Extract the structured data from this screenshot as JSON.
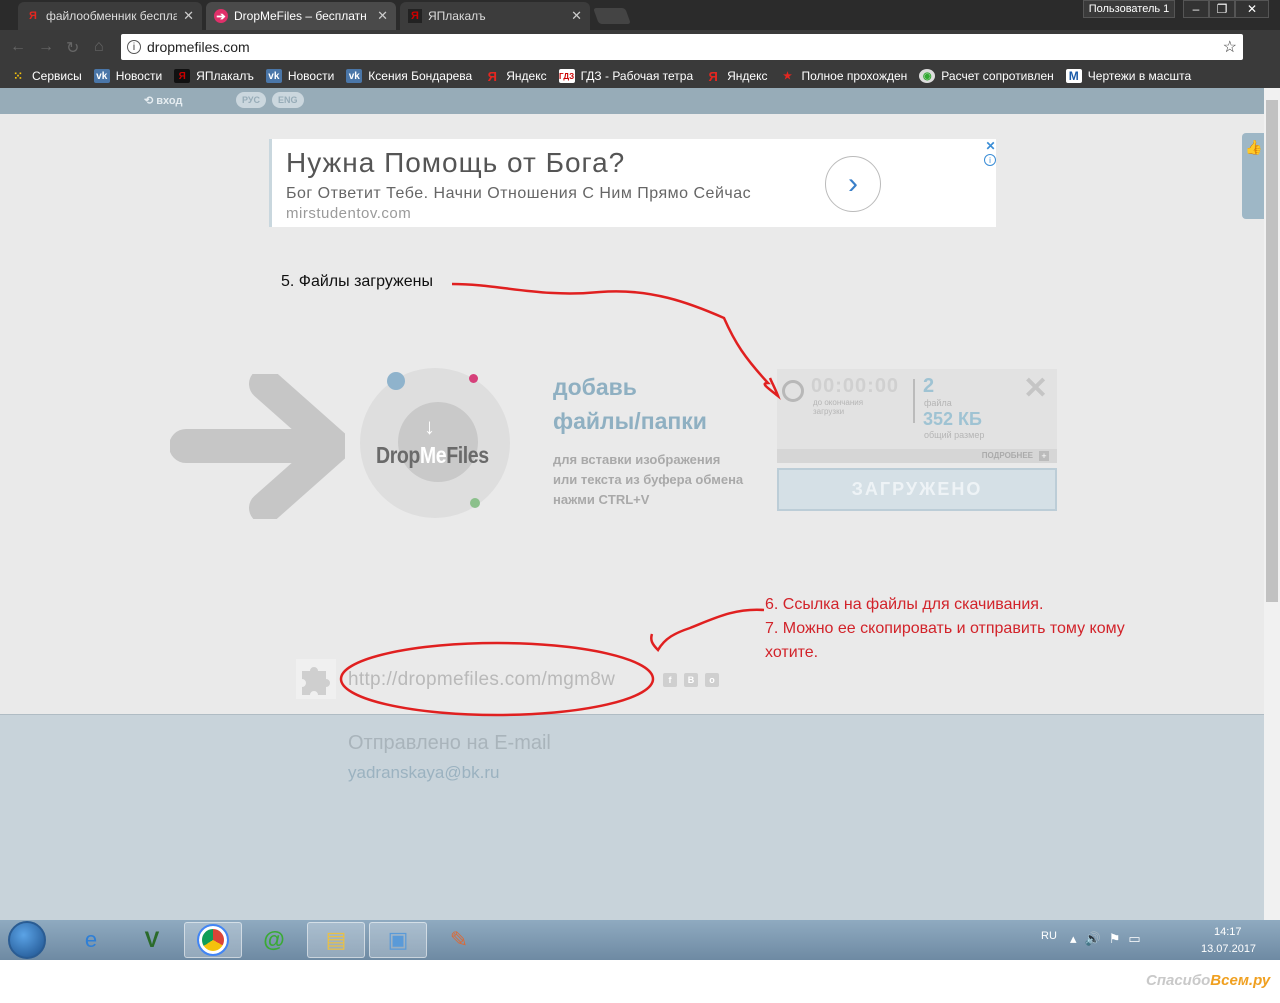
{
  "browser": {
    "tabs": [
      {
        "title": "файлообменник беспла",
        "favicon": "yandex-icon",
        "active": false
      },
      {
        "title": "DropMeFiles – бесплатн",
        "favicon": "dropmefiles-icon",
        "active": true
      },
      {
        "title": "ЯПлакалъ",
        "favicon": "yaplakal-icon",
        "active": false
      }
    ],
    "user_label": "Пользователь 1",
    "url": "dropmefiles.com",
    "bookmarks": [
      {
        "label": "Сервисы",
        "icon": "apps-grid-icon"
      },
      {
        "label": "Новости",
        "icon": "vk-icon"
      },
      {
        "label": "ЯПлакалъ",
        "icon": "yaplakal-icon"
      },
      {
        "label": "Новости",
        "icon": "vk-icon"
      },
      {
        "label": "Ксения Бондарева",
        "icon": "vk-icon"
      },
      {
        "label": "Яндекс",
        "icon": "yandex-icon"
      },
      {
        "label": "ГДЗ - Рабочая тетра",
        "icon": "gdz-icon"
      },
      {
        "label": "Яндекс",
        "icon": "yandex-icon"
      },
      {
        "label": "Полное прохожден",
        "icon": "star-icon"
      },
      {
        "label": "Расчет сопротивлен",
        "icon": "globe-icon"
      },
      {
        "label": "Чертежи в масшта",
        "icon": "m-icon"
      }
    ]
  },
  "site": {
    "login_label": "вход",
    "lang_ru": "РУС",
    "lang_en": "ENG"
  },
  "ad": {
    "title": "Нужна Помощь от Бога?",
    "description": "Бог Ответит Тебе. Начни Отношения С Ним Прямо Сейчас",
    "url": "mirstudentov.com"
  },
  "annotations": {
    "step5": "5. Файлы загружены",
    "step6": "6. Ссылка на файлы для скачивания.",
    "step7": "7. Можно ее скопировать и отправить тому кому хотите."
  },
  "uploader": {
    "logo_drop": "Drop",
    "logo_me": "Me",
    "logo_files": "Files",
    "add_title_line1": "добавь",
    "add_title_line2": "файлы/папки",
    "hint_line1": "для вставки изображения",
    "hint_line2": "или текста из буфера обмена",
    "hint_line3": "нажми CTRL+V",
    "timer": "00:00:00",
    "timer_label_line1": "до окончания",
    "timer_label_line2": "загрузки",
    "file_count": "2",
    "file_count_label": "файла",
    "total_size": "352 КБ",
    "total_size_label": "общий размер",
    "more_label": "ПОДРОБНЕЕ",
    "done_label": "ЗАГРУЖЕНО"
  },
  "result": {
    "link": "http://dropmefiles.com/mgm8w",
    "sent_label": "Отправлено на E-mail",
    "email": "yadranskaya@bk.ru"
  },
  "taskbar": {
    "lang": "RU",
    "time": "14:17",
    "date": "13.07.2017"
  },
  "watermark": {
    "part1": "Спасибо",
    "part2": "Всем.ру"
  },
  "colors": {
    "annotation_red": "#d2232a",
    "site_accent": "#97acb8"
  }
}
